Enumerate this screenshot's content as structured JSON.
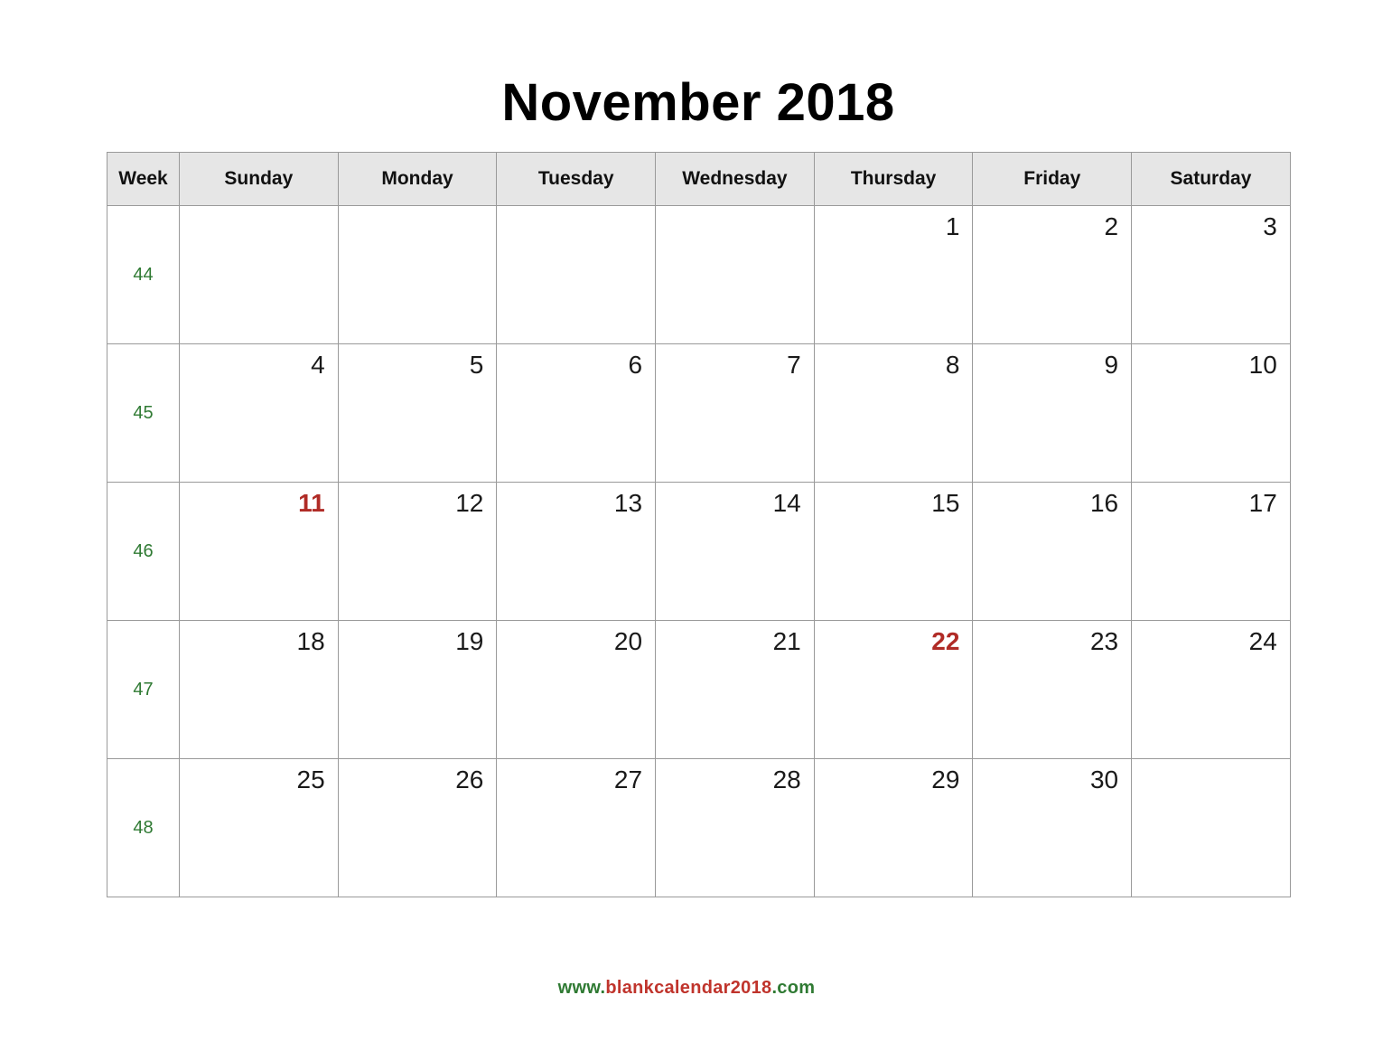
{
  "title": "November 2018",
  "colors": {
    "header_bg": "#e6e6e6",
    "grid_border": "#9a9a9a",
    "week_number": "#2f7a33",
    "highlight_day": "#b02b26",
    "day_text": "#1a1a1a",
    "footer_green": "#2f7a33",
    "footer_red": "#c0342c"
  },
  "header": {
    "week_label": "Week",
    "days": [
      "Sunday",
      "Monday",
      "Tuesday",
      "Wednesday",
      "Thursday",
      "Friday",
      "Saturday"
    ]
  },
  "weeks": [
    {
      "week_number": "44",
      "days": [
        {
          "num": "",
          "highlight": false
        },
        {
          "num": "",
          "highlight": false
        },
        {
          "num": "",
          "highlight": false
        },
        {
          "num": "",
          "highlight": false
        },
        {
          "num": "1",
          "highlight": false
        },
        {
          "num": "2",
          "highlight": false
        },
        {
          "num": "3",
          "highlight": false
        }
      ]
    },
    {
      "week_number": "45",
      "days": [
        {
          "num": "4",
          "highlight": false
        },
        {
          "num": "5",
          "highlight": false
        },
        {
          "num": "6",
          "highlight": false
        },
        {
          "num": "7",
          "highlight": false
        },
        {
          "num": "8",
          "highlight": false
        },
        {
          "num": "9",
          "highlight": false
        },
        {
          "num": "10",
          "highlight": false
        }
      ]
    },
    {
      "week_number": "46",
      "days": [
        {
          "num": "11",
          "highlight": true
        },
        {
          "num": "12",
          "highlight": false
        },
        {
          "num": "13",
          "highlight": false
        },
        {
          "num": "14",
          "highlight": false
        },
        {
          "num": "15",
          "highlight": false
        },
        {
          "num": "16",
          "highlight": false
        },
        {
          "num": "17",
          "highlight": false
        }
      ]
    },
    {
      "week_number": "47",
      "days": [
        {
          "num": "18",
          "highlight": false
        },
        {
          "num": "19",
          "highlight": false
        },
        {
          "num": "20",
          "highlight": false
        },
        {
          "num": "21",
          "highlight": false
        },
        {
          "num": "22",
          "highlight": true
        },
        {
          "num": "23",
          "highlight": false
        },
        {
          "num": "24",
          "highlight": false
        }
      ]
    },
    {
      "week_number": "48",
      "days": [
        {
          "num": "25",
          "highlight": false
        },
        {
          "num": "26",
          "highlight": false
        },
        {
          "num": "27",
          "highlight": false
        },
        {
          "num": "28",
          "highlight": false
        },
        {
          "num": "29",
          "highlight": false
        },
        {
          "num": "30",
          "highlight": false
        },
        {
          "num": "",
          "highlight": false
        }
      ]
    }
  ],
  "footer": {
    "prefix": "www.",
    "name": "blankcalendar2018",
    "suffix": ".com",
    "full": "www.blankcalendar2018.com"
  }
}
